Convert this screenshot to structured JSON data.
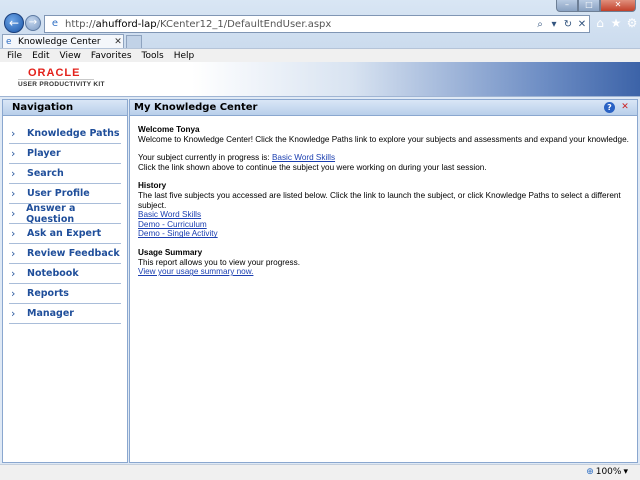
{
  "browser": {
    "window_buttons": {
      "minimize": "–",
      "maximize": "□",
      "close": "✕"
    },
    "back_glyph": "←",
    "forward_glyph": "→",
    "address": {
      "prefix": "http://",
      "host": "ahufford-lap",
      "path": "/KCenter12_1/DefaultEndUser.aspx"
    },
    "address_tools": {
      "search": "⌕",
      "dropdown": "▾",
      "refresh": "↻",
      "stop": "✕"
    },
    "tab": {
      "title": "Knowledge Center",
      "close": "✕"
    },
    "menu": [
      "File",
      "Edit",
      "View",
      "Favorites",
      "Tools",
      "Help"
    ],
    "toolbar_icons": {
      "home": "⌂",
      "favorites": "★",
      "tools": "⚙"
    },
    "status": {
      "zoom": "100%",
      "zoom_arrow": "▾"
    }
  },
  "app": {
    "logo": {
      "brand": "ORACLE",
      "product": "USER PRODUCTIVITY KIT"
    }
  },
  "navigation": {
    "title": "Navigation",
    "items": [
      {
        "label": "Knowledge Paths"
      },
      {
        "label": "Player"
      },
      {
        "label": "Search"
      },
      {
        "label": "User Profile"
      },
      {
        "label": "Answer a Question"
      },
      {
        "label": "Ask an Expert"
      },
      {
        "label": "Review Feedback"
      },
      {
        "label": "Notebook"
      },
      {
        "label": "Reports"
      },
      {
        "label": "Manager"
      }
    ]
  },
  "main": {
    "title": "My Knowledge Center",
    "help_glyph": "?",
    "exit_glyph": "✕",
    "welcome": {
      "title": "Welcome Tonya",
      "text": "Welcome to Knowledge Center! Click the Knowledge Paths link to explore your subjects and assessments and expand your knowledge."
    },
    "in_progress": {
      "label": "Your subject currently in progress is: ",
      "link": "Basic Word Skills",
      "note": "Click the link shown above to continue the subject you were working on during your last session."
    },
    "history": {
      "title": "History",
      "text": "The last five subjects you accessed are listed below. Click the link to launch the subject, or click Knowledge Paths to select a different subject.",
      "links": [
        "Basic Word Skills",
        "Demo - Curriculum",
        "Demo - Single Activity"
      ]
    },
    "usage": {
      "title": "Usage Summary",
      "text": "This report allows you to view your progress.",
      "link": "View your usage summary now."
    }
  }
}
